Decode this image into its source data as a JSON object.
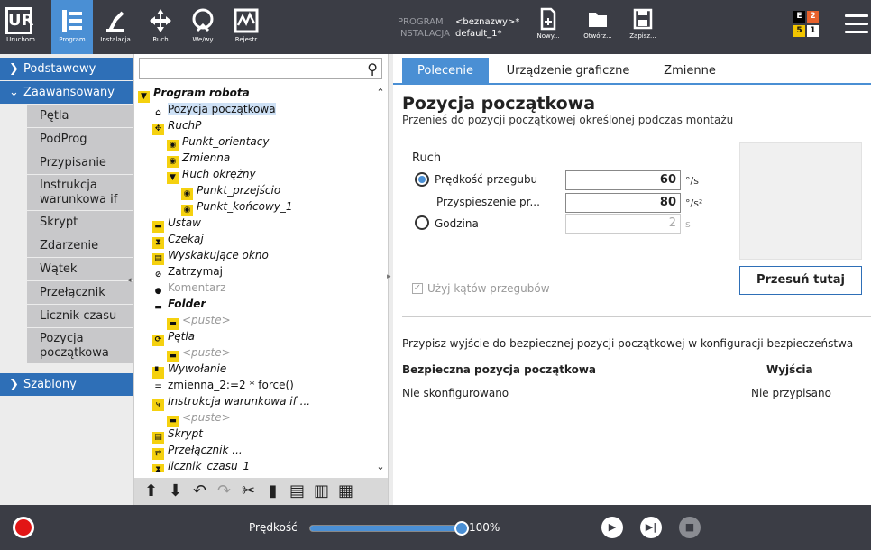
{
  "topbar": {
    "buttons": [
      {
        "label": "Uruchom"
      },
      {
        "label": "Program"
      },
      {
        "label": "Instalacja"
      },
      {
        "label": "Ruch"
      },
      {
        "label": "We/wy"
      },
      {
        "label": "Rejestr"
      }
    ],
    "program_key": "PROGRAM",
    "program_val": "<beznazwy>*",
    "install_key": "INSTALACJA",
    "install_val": "default_1*",
    "file_buttons": [
      {
        "label": "Nowy..."
      },
      {
        "label": "Otwórz..."
      },
      {
        "label": "Zapisz..."
      }
    ],
    "status": {
      "e": "E",
      "e2": "2",
      "s5": "5",
      "s1": "1"
    }
  },
  "left": {
    "categories": [
      {
        "label": "Podstawowy"
      },
      {
        "label": "Zaawansowany"
      },
      {
        "label": "Szablony"
      }
    ],
    "nodes": [
      "Pętla",
      "PodProg",
      "Przypisanie",
      "Instrukcja\nwarunkowa if",
      "Skrypt",
      "Zdarzenie",
      "Wątek",
      "Przełącznik",
      "Licznik czasu",
      "Pozycja\npoczątkowa"
    ]
  },
  "tree": {
    "search_placeholder": "",
    "rows": [
      "Program robota",
      "Pozycja początkowa",
      "RuchP",
      "Punkt_orientacy",
      "Zmienna",
      "Ruch okrężny",
      "Punkt_przejścio",
      "Punkt_końcowy_1",
      "Ustaw",
      "Czekaj",
      "Wyskakujące okno",
      "Zatrzymaj",
      "Komentarz",
      "Folder",
      "<puste>",
      "Pętla",
      "<puste>",
      "Wywołanie",
      "zmienna_2:=2 * force()",
      "Instrukcja warunkowa if ...",
      "<puste>",
      "Skrypt",
      "Przełącznik ...",
      "licznik_czasu_1"
    ]
  },
  "right": {
    "tabs": [
      "Polecenie",
      "Urządzenie graficzne",
      "Zmienne"
    ],
    "title": "Pozycja początkowa",
    "subtitle": "Przenieś do pozycji początkowej określonej podczas montażu",
    "move_label": "Ruch",
    "opt1": "Prędkość przegubu",
    "val1": "60",
    "unit1": "°/s",
    "opt2": "Przyspieszenie pr...",
    "val2": "80",
    "unit2": "°/s²",
    "opt3": "Godzina",
    "val3": "2",
    "unit3": "s",
    "move_btn": "Przesuń tutaj",
    "use_angles": "Użyj kątów przegubów",
    "safe_info": "Przypisz wyjście do bezpiecznej pozycji początkowej w konfiguracji bezpieczeństwa",
    "col1": "Bezpieczna pozycja początkowa",
    "col2": "Wyjścia",
    "cell1": "Nie skonfigurowano",
    "cell2": "Nie przypisano"
  },
  "bottom": {
    "speed_label": "Prędkość",
    "speed_value": "100%",
    "speed_fraction": 1.0
  }
}
